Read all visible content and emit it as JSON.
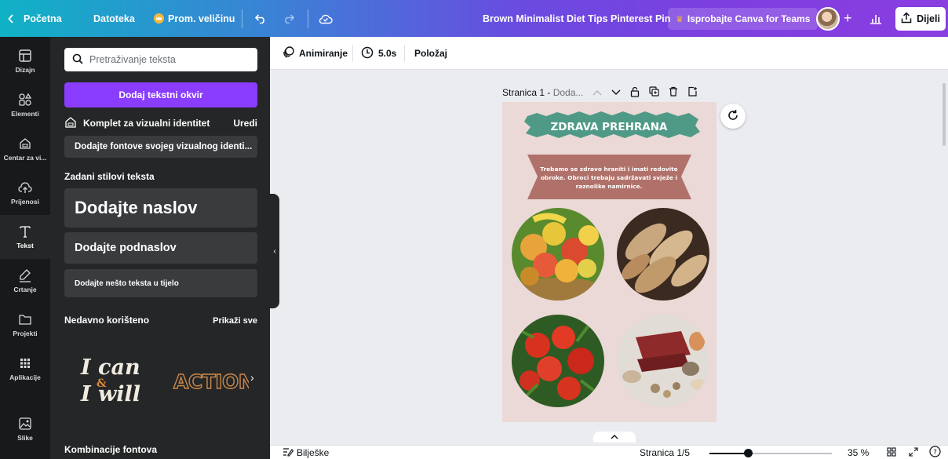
{
  "topbar": {
    "home": "Početna",
    "file": "Datoteka",
    "resize": "Prom. veličinu",
    "doc_title": "Brown Minimalist Diet Tips Pinterest Pin",
    "try_teams": "Isprobajte Canva for Teams",
    "share": "Dijeli"
  },
  "rail": [
    {
      "label": "Dizajn",
      "icon": "layout-icon"
    },
    {
      "label": "Elementi",
      "icon": "shapes-icon"
    },
    {
      "label": "Centar za vi...",
      "icon": "brand-kit-icon"
    },
    {
      "label": "Prijenosi",
      "icon": "cloud-upload-icon"
    },
    {
      "label": "Tekst",
      "icon": "text-icon"
    },
    {
      "label": "Crtanje",
      "icon": "draw-icon"
    },
    {
      "label": "Projekti",
      "icon": "folder-icon"
    },
    {
      "label": "Aplikacije",
      "icon": "apps-grid-icon"
    },
    {
      "label": "Slike",
      "icon": "image-icon"
    }
  ],
  "panel": {
    "search_placeholder": "Pretraživanje teksta",
    "add_textbox": "Dodaj tekstni okvir",
    "brand_kit": "Komplet za vizualni identitet",
    "edit": "Uredi",
    "brand_fonts": "Dodajte fontove svojeg vizualnog identi...",
    "default_styles": "Zadani stilovi teksta",
    "heading": "Dodajte naslov",
    "subheading": "Dodajte podnaslov",
    "body": "Dodajte nešto teksta u tijelo",
    "recent": "Nedavno korišteno",
    "see_all": "Prikaži sve",
    "recent_items": [
      "I can & I will",
      "ACTION"
    ],
    "font_combos": "Kombinacije fontova"
  },
  "editor_toolbar": {
    "animate": "Animiranje",
    "duration": "5.0s",
    "position": "Položaj"
  },
  "page_header": {
    "page_label": "Stranica 1 -",
    "page_title": "Doda..."
  },
  "design": {
    "title": "ZDRAVA PREHRANA",
    "body": "Trebamo se zdravo hraniti i imati redovite obroke. Obroci trebaju sadržavati svježe i raznolike namirnice.",
    "photos": [
      "fruit-basket",
      "bread-loaves",
      "tomatoes",
      "meat-and-eggs"
    ]
  },
  "bottombar": {
    "notes": "Bilješke",
    "page_count": "Stranica 1/5",
    "zoom": "35 %",
    "zoom_level": 0.35
  },
  "colors": {
    "accent": "#8b3dff",
    "design_bg": "#ead9d6",
    "title_banner": "#4f9a86",
    "body_banner": "#b0716a"
  }
}
